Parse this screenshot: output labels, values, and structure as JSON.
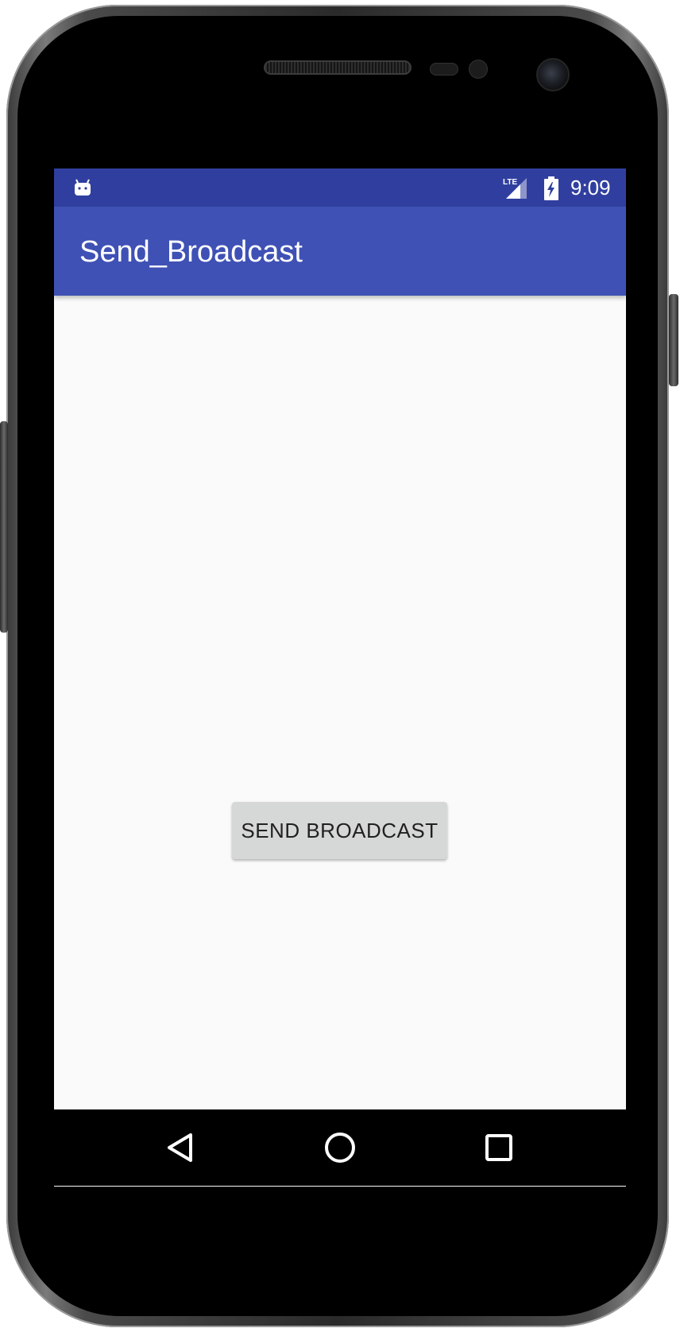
{
  "device": {
    "icons": [
      "speaker-grille",
      "proximity-sensor",
      "front-camera"
    ]
  },
  "status_bar": {
    "notification_icon": "android-icon",
    "network": "LTE",
    "battery_icon": "battery-charging-icon",
    "time": "9:09",
    "color": "#303f9f"
  },
  "app_bar": {
    "title": "Send_Broadcast",
    "color": "#3f51b5"
  },
  "main": {
    "send_button_label": "SEND BROADCAST",
    "background": "#fafafa"
  },
  "nav_bar": {
    "back_icon": "back-triangle-icon",
    "home_icon": "home-circle-icon",
    "recents_icon": "recents-square-icon"
  }
}
